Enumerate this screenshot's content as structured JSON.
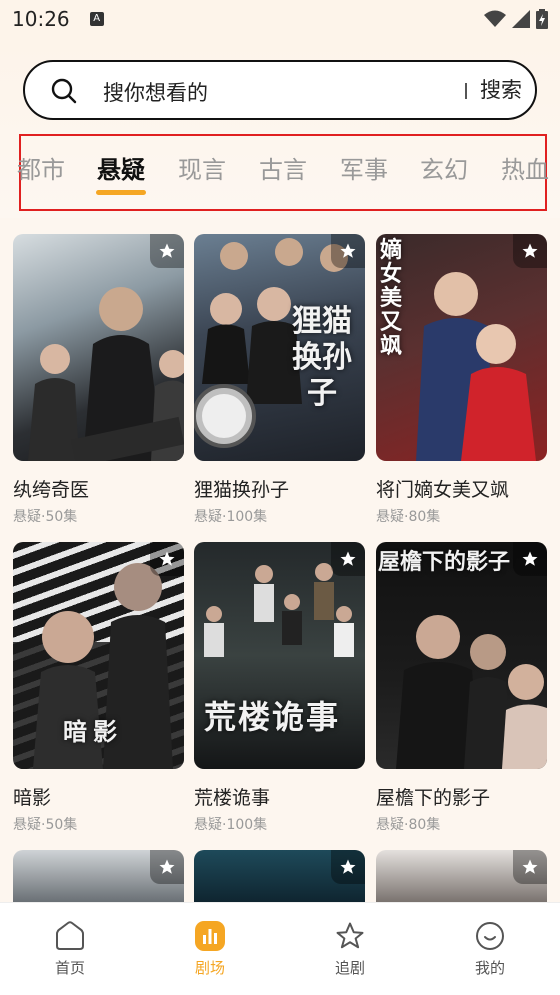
{
  "status_bar": {
    "time": "10:26",
    "notification_icon": "A"
  },
  "search": {
    "placeholder": "搜你想看的",
    "button_label": "搜索"
  },
  "tabs": [
    {
      "label": "都市",
      "active": false
    },
    {
      "label": "悬疑",
      "active": true
    },
    {
      "label": "现言",
      "active": false
    },
    {
      "label": "古言",
      "active": false
    },
    {
      "label": "军事",
      "active": false
    },
    {
      "label": "玄幻",
      "active": false
    },
    {
      "label": "热血",
      "active": false
    }
  ],
  "dramas": [
    {
      "title": "纨绔奇医",
      "meta": "悬疑·50集"
    },
    {
      "title": "狸猫换孙子",
      "meta": "悬疑·100集",
      "poster_text": "狸猫换孙子"
    },
    {
      "title": "将门嫡女美又飒",
      "meta": "悬疑·80集",
      "poster_text": "嫡女美又飒"
    },
    {
      "title": "暗影",
      "meta": "悬疑·50集",
      "poster_text": "暗影"
    },
    {
      "title": "荒楼诡事",
      "meta": "悬疑·100集",
      "poster_text": "荒楼诡事"
    },
    {
      "title": "屋檐下的影子",
      "meta": "悬疑·80集",
      "poster_text": "屋檐下的影子"
    }
  ],
  "bottom_nav": [
    {
      "label": "首页",
      "icon": "home-icon",
      "active": false
    },
    {
      "label": "剧场",
      "icon": "theater-icon",
      "active": true
    },
    {
      "label": "追剧",
      "icon": "star-icon",
      "active": false
    },
    {
      "label": "我的",
      "icon": "profile-icon",
      "active": false
    }
  ],
  "colors": {
    "accent": "#f5a623",
    "highlight_border": "#e02020",
    "background": "#fdf6ef"
  }
}
